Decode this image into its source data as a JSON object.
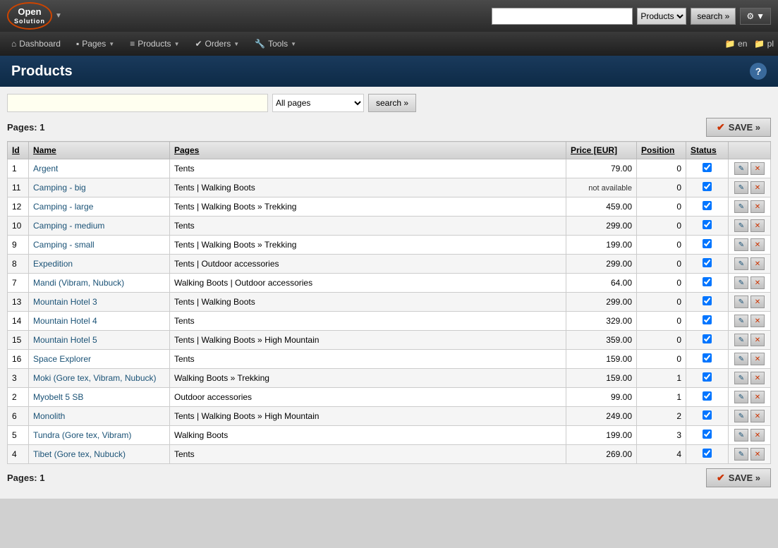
{
  "topbar": {
    "logo_line1": "Open",
    "logo_line2": "Solution",
    "search_placeholder": "",
    "search_category": "Products",
    "search_button": "search »",
    "gear_icon": "⚙",
    "dropdown_arrow": "▼"
  },
  "navbar": {
    "items": [
      {
        "id": "dashboard",
        "icon": "⌂",
        "label": "Dashboard",
        "has_arrow": false
      },
      {
        "id": "pages",
        "icon": "📄",
        "label": "Pages",
        "has_arrow": true
      },
      {
        "id": "products",
        "icon": "☰",
        "label": "Products",
        "has_arrow": true
      },
      {
        "id": "orders",
        "icon": "✔",
        "label": "Orders",
        "has_arrow": true
      },
      {
        "id": "tools",
        "icon": "🔧",
        "label": "Tools",
        "has_arrow": true
      }
    ],
    "right_items": [
      {
        "id": "lang-en",
        "icon": "📁",
        "label": "en"
      },
      {
        "id": "lang-pl",
        "icon": "📁",
        "label": "pl"
      }
    ]
  },
  "page_header": {
    "title": "Products",
    "help_label": "?"
  },
  "filter": {
    "search_placeholder": "",
    "pages_option": "All pages",
    "search_btn": "search »"
  },
  "pages_bar": {
    "label": "Pages:",
    "page_number": "1",
    "save_label": "SAVE »"
  },
  "table": {
    "columns": [
      "Id",
      "Name",
      "Pages",
      "Price [EUR]",
      "Position",
      "Status",
      ""
    ],
    "rows": [
      {
        "id": "1",
        "name": "Argent",
        "pages": "Tents",
        "price": "79.00",
        "position": "0",
        "status": true
      },
      {
        "id": "11",
        "name": "Camping - big",
        "pages": "Tents | Walking Boots",
        "price": "not available",
        "position": "0",
        "status": true
      },
      {
        "id": "12",
        "name": "Camping - large",
        "pages": "Tents | Walking Boots » Trekking",
        "price": "459.00",
        "position": "0",
        "status": true
      },
      {
        "id": "10",
        "name": "Camping - medium",
        "pages": "Tents",
        "price": "299.00",
        "position": "0",
        "status": true
      },
      {
        "id": "9",
        "name": "Camping - small",
        "pages": "Tents | Walking Boots » Trekking",
        "price": "199.00",
        "position": "0",
        "status": true
      },
      {
        "id": "8",
        "name": "Expedition",
        "pages": "Tents | Outdoor accessories",
        "price": "299.00",
        "position": "0",
        "status": true
      },
      {
        "id": "7",
        "name": "Mandi (Vibram, Nubuck)",
        "pages": "Walking Boots | Outdoor accessories",
        "price": "64.00",
        "position": "0",
        "status": true
      },
      {
        "id": "13",
        "name": "Mountain Hotel 3",
        "pages": "Tents | Walking Boots",
        "price": "299.00",
        "position": "0",
        "status": true
      },
      {
        "id": "14",
        "name": "Mountain Hotel 4",
        "pages": "Tents",
        "price": "329.00",
        "position": "0",
        "status": true
      },
      {
        "id": "15",
        "name": "Mountain Hotel 5",
        "pages": "Tents | Walking Boots » High Mountain",
        "price": "359.00",
        "position": "0",
        "status": true
      },
      {
        "id": "16",
        "name": "Space Explorer",
        "pages": "Tents",
        "price": "159.00",
        "position": "0",
        "status": true
      },
      {
        "id": "3",
        "name": "Moki (Gore tex, Vibram, Nubuck)",
        "pages": "Walking Boots » Trekking",
        "price": "159.00",
        "position": "1",
        "status": true
      },
      {
        "id": "2",
        "name": "Myobelt 5 SB",
        "pages": "Outdoor accessories",
        "price": "99.00",
        "position": "1",
        "status": true
      },
      {
        "id": "6",
        "name": "Monolith",
        "pages": "Tents | Walking Boots » High Mountain",
        "price": "249.00",
        "position": "2",
        "status": true
      },
      {
        "id": "5",
        "name": "Tundra (Gore tex, Vibram)",
        "pages": "Walking Boots",
        "price": "199.00",
        "position": "3",
        "status": true
      },
      {
        "id": "4",
        "name": "Tibet (Gore tex, Nubuck)",
        "pages": "Tents",
        "price": "269.00",
        "position": "4",
        "status": true
      }
    ]
  }
}
